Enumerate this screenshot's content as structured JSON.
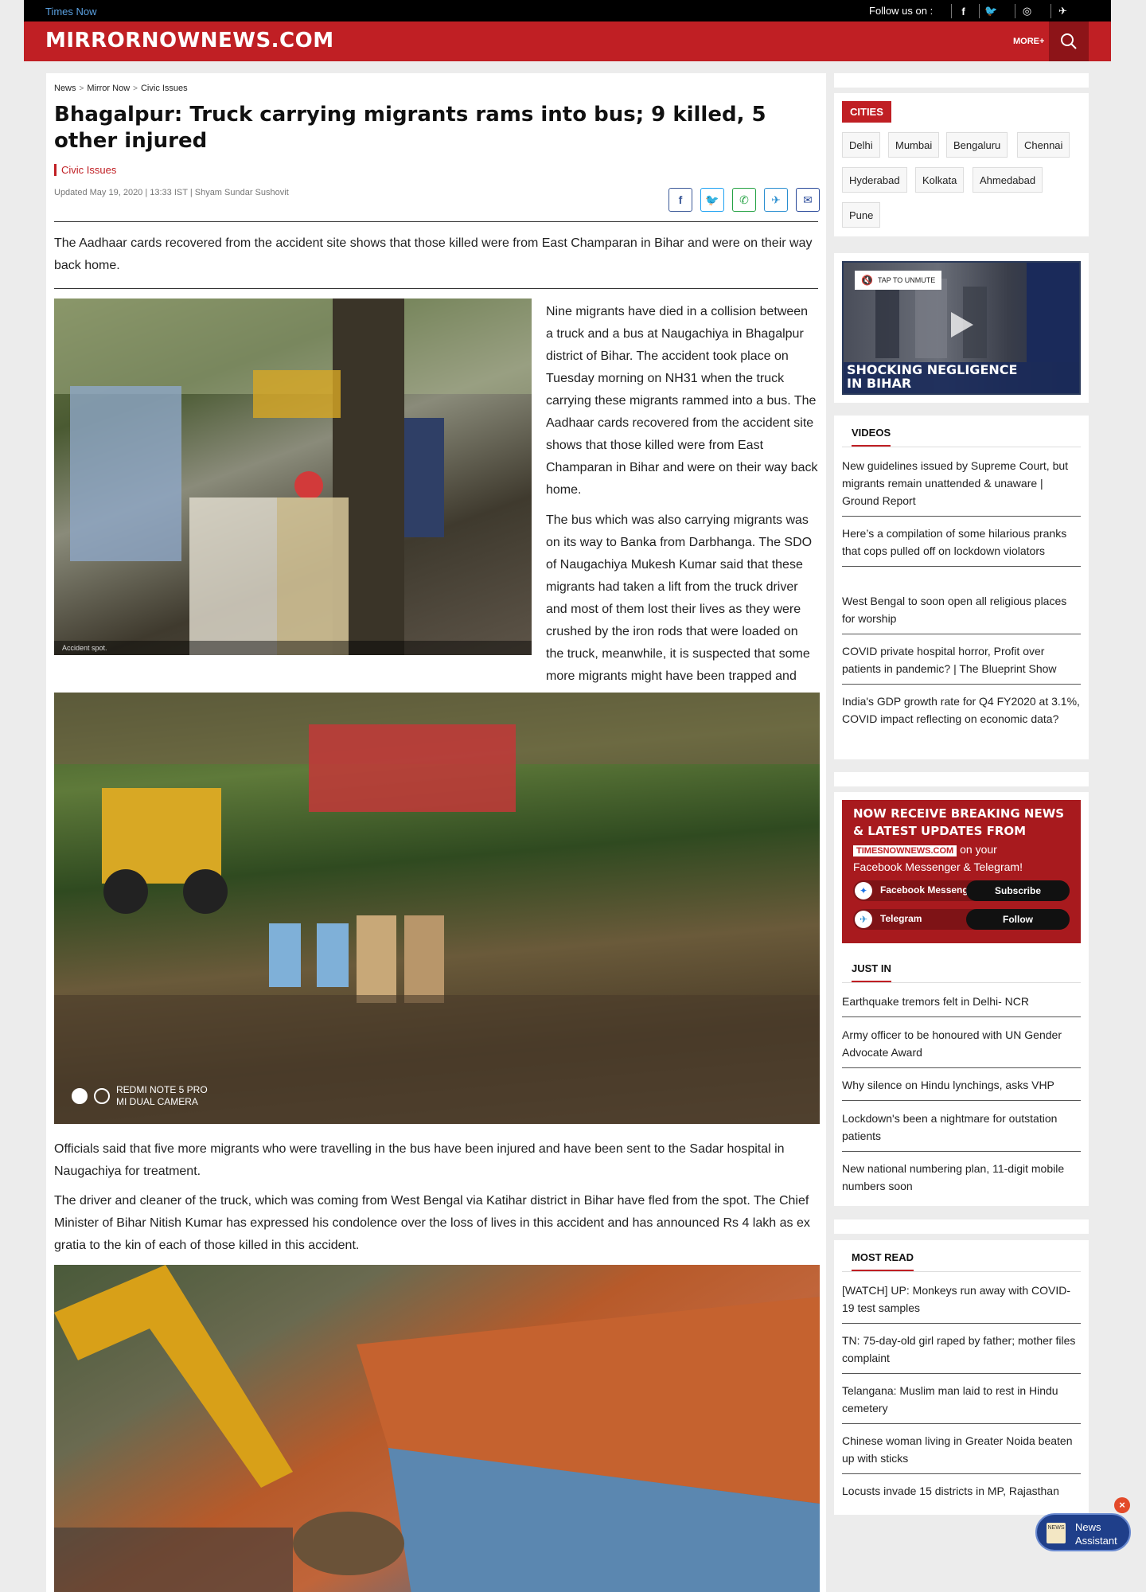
{
  "topbar": {
    "brand_link": "Times Now",
    "follow_label": "Follow us on :",
    "socials": [
      "f",
      "🐦",
      "◎",
      "✈"
    ]
  },
  "header": {
    "logo": "MIRRORNOWNEWS.COM",
    "more_label": "MORE+"
  },
  "article": {
    "breadcrumbs": [
      "News",
      "Mirror Now",
      "Civic Issues"
    ],
    "title": "Bhagalpur: Truck carrying migrants rams into bus; 9 killed, 5 other injured",
    "category": "Civic Issues",
    "updated": "Updated May 19, 2020 | 13:33 IST | Shyam Sundar Sushovit",
    "summary": "The Aadhaar cards recovered from the accident site shows that those killed were from East Champaran in Bihar and were on their way back home.",
    "image1_caption": "Accident spot.",
    "para1": "Nine migrants have died in a collision between a truck and a bus at Naugachiya in Bhagalpur district of Bihar. The accident took place on Tuesday morning on NH31 when the truck carrying these migrants rammed into a bus. The Aadhaar cards recovered from the accident site shows that those killed were from East Champaran in Bihar and were on their way back home.",
    "para2": "The bus which was also carrying migrants was on its way to Banka from Darbhanga. The SDO of Naugachiya Mukesh Kumar said that these migrants had taken a lift from the truck driver and most of them lost their lives as they were crushed by the iron rods that were loaded on the truck, meanwhile, it is suspected that some more migrants might have been trapped and rescue operation is underway.",
    "image2_watermark_line1": "REDMI NOTE 5 PRO",
    "image2_watermark_line2": "MI DUAL CAMERA",
    "para3": "Officials said that five more migrants who were travelling in the bus have been injured and have been sent to the Sadar hospital in Naugachiya for treatment.",
    "para4": "The driver and cleaner of the truck, which was coming from West Bengal via Katihar district in Bihar have fled from the spot. The Chief Minister of Bihar Nitish Kumar has expressed his condolence over the loss of lives in this accident and has announced Rs 4 lakh as ex gratia to the kin of each of those killed in this accident.",
    "share_buttons": [
      {
        "icon": "f",
        "color": "#3b5998"
      },
      {
        "icon": "🐦",
        "color": "#1da1f2"
      },
      {
        "icon": "✆",
        "color": "#25a244"
      },
      {
        "icon": "✈",
        "color": "#2a8ed0"
      },
      {
        "icon": "✉",
        "color": "#2a4a9a"
      }
    ]
  },
  "sidebar": {
    "cities_title": "CITIES",
    "cities": [
      "Delhi",
      "Mumbai",
      "Bengaluru",
      "Chennai",
      "Hyderabad",
      "Kolkata",
      "Ahmedabad",
      "Pune"
    ],
    "video": {
      "unmute": "TAP TO UNMUTE",
      "headline_line1": "SHOCKING NEGLIGENCE",
      "headline_line2": "IN BIHAR"
    },
    "videos_title": "VIDEOS",
    "videos": [
      "New guidelines issued by Supreme Court, but migrants remain unattended & unaware | Ground Report",
      "Here’s a compilation of some hilarious pranks that cops pulled off on lockdown violators",
      "West Bengal to soon open all religious places for worship",
      "COVID private hospital horror, Profit over patients in pandemic? | The Blueprint Show",
      "India's GDP growth rate for Q4 FY2020 at 3.1%, COVID impact reflecting on economic data?"
    ],
    "promo": {
      "heading_line1": "NOW RECEIVE BREAKING NEWS",
      "heading_line2": "& LATEST UPDATES FROM",
      "brand": "TIMESNOWNEWS.COM",
      "suffix": " on your",
      "line4": "Facebook Messenger & Telegram!",
      "fb_label": "Facebook Messenger",
      "fb_button": "Subscribe",
      "tg_label": "Telegram",
      "tg_button": "Follow"
    },
    "justin_title": "JUST IN",
    "justin": [
      "Earthquake tremors felt in Delhi- NCR",
      "Army officer to be honoured with UN Gender Advocate Award",
      "Why silence on Hindu lynchings, asks VHP",
      "Lockdown's been a nightmare for outstation patients",
      "New national numbering plan, 11-digit mobile numbers soon"
    ],
    "mostread_title": "MOST READ",
    "mostread": [
      "[WATCH] UP: Monkeys run away with COVID-19 test samples",
      "TN: 75-day-old girl raped by father; mother files complaint",
      "Telangana: Muslim man laid to rest in Hindu cemetery",
      "Chinese woman living in Greater Noida beaten up with sticks",
      "Locusts invade 15 districts in MP, Rajasthan"
    ]
  },
  "assistant": {
    "line1": "News",
    "line2": "Assistant",
    "icon_text": "NEWS"
  },
  "colors": {
    "brand_red": "#c01f24",
    "dark_red": "#8d1418",
    "topbar": "#000000"
  }
}
